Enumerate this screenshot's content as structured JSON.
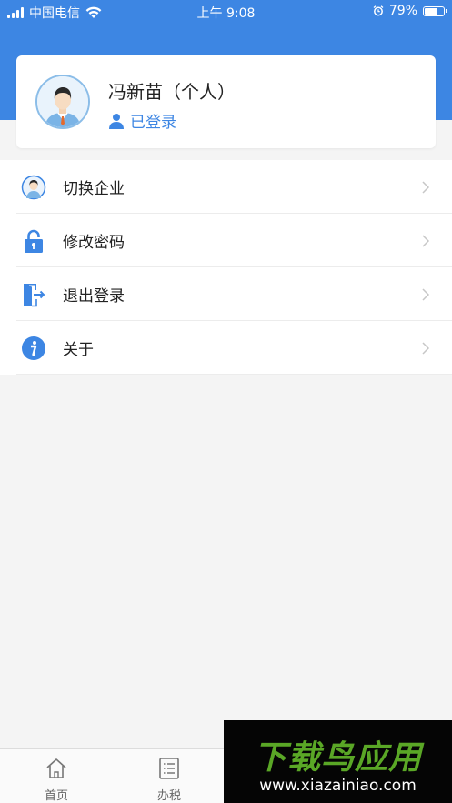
{
  "status_bar": {
    "carrier": "中国电信",
    "time": "上午 9:08",
    "battery": "79%",
    "battery_level": 0.79,
    "icons": [
      "signal-icon",
      "wifi-icon",
      "alarm-icon",
      "battery-icon"
    ]
  },
  "profile": {
    "name": "冯新苗（个人）",
    "status": "已登录",
    "avatar_icon": "user-avatar-icon",
    "status_icon": "person-icon"
  },
  "menu": {
    "items": [
      {
        "label": "切换企业",
        "icon": "switch-company-icon"
      },
      {
        "label": "修改密码",
        "icon": "lock-icon"
      },
      {
        "label": "退出登录",
        "icon": "logout-door-icon"
      },
      {
        "label": "关于",
        "icon": "info-icon"
      }
    ]
  },
  "tabs": [
    {
      "label": "首页",
      "icon": "home-icon"
    },
    {
      "label": "办税",
      "icon": "list-icon"
    }
  ],
  "watermark": {
    "title": "下载鸟应用",
    "url": "www.xiazainiao.com"
  },
  "colors": {
    "header_blue": "#3d86e3",
    "accent": "#3d86e3",
    "watermark_green": "#5aa726"
  }
}
